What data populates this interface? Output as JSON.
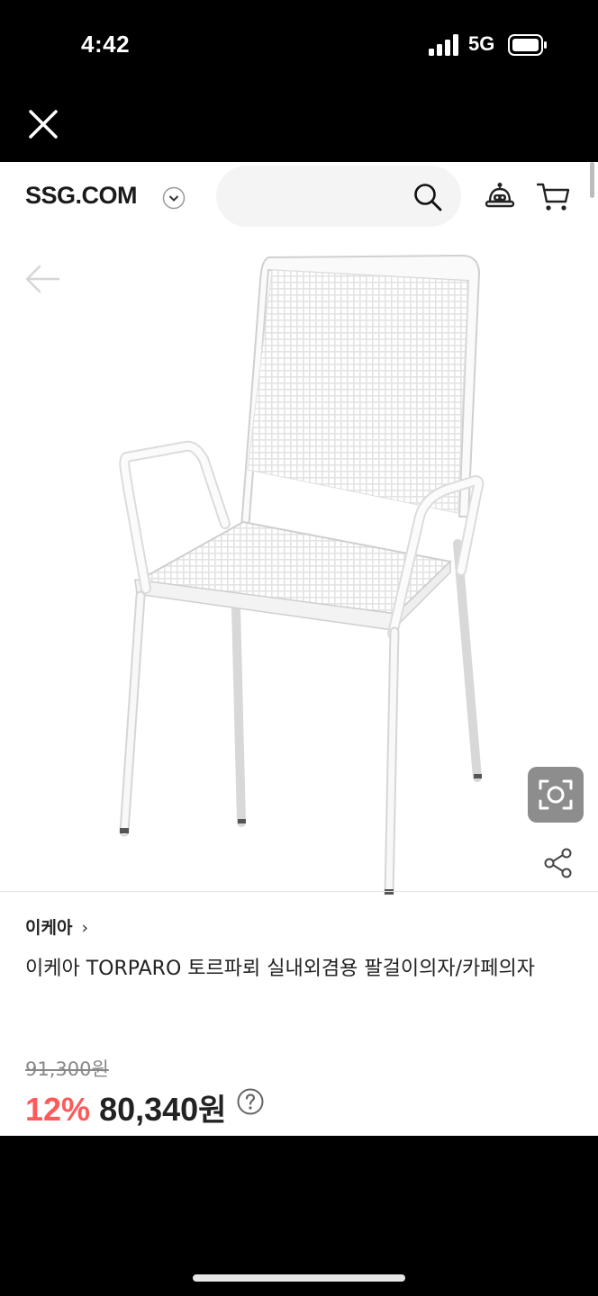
{
  "status": {
    "time": "4:42",
    "network": "5G"
  },
  "header": {
    "logo": "SSG.COM",
    "search_placeholder": ""
  },
  "product": {
    "brand": "이케아",
    "title": "이케아 TORPARO 토르파뢰 실내외겸용 팔걸이의자/카페의자",
    "original_price": "91,300원",
    "discount": "12%",
    "price": "80,340",
    "price_unit": "원"
  },
  "colors": {
    "discount": "#ff5a5a",
    "text": "#222222",
    "muted": "#888888"
  },
  "icons": [
    "close-icon",
    "search-icon",
    "chatbot-icon",
    "cart-icon",
    "back-arrow-icon",
    "camera-scan-icon",
    "share-icon",
    "help-icon",
    "chevron-down-icon",
    "chevron-right-icon"
  ]
}
